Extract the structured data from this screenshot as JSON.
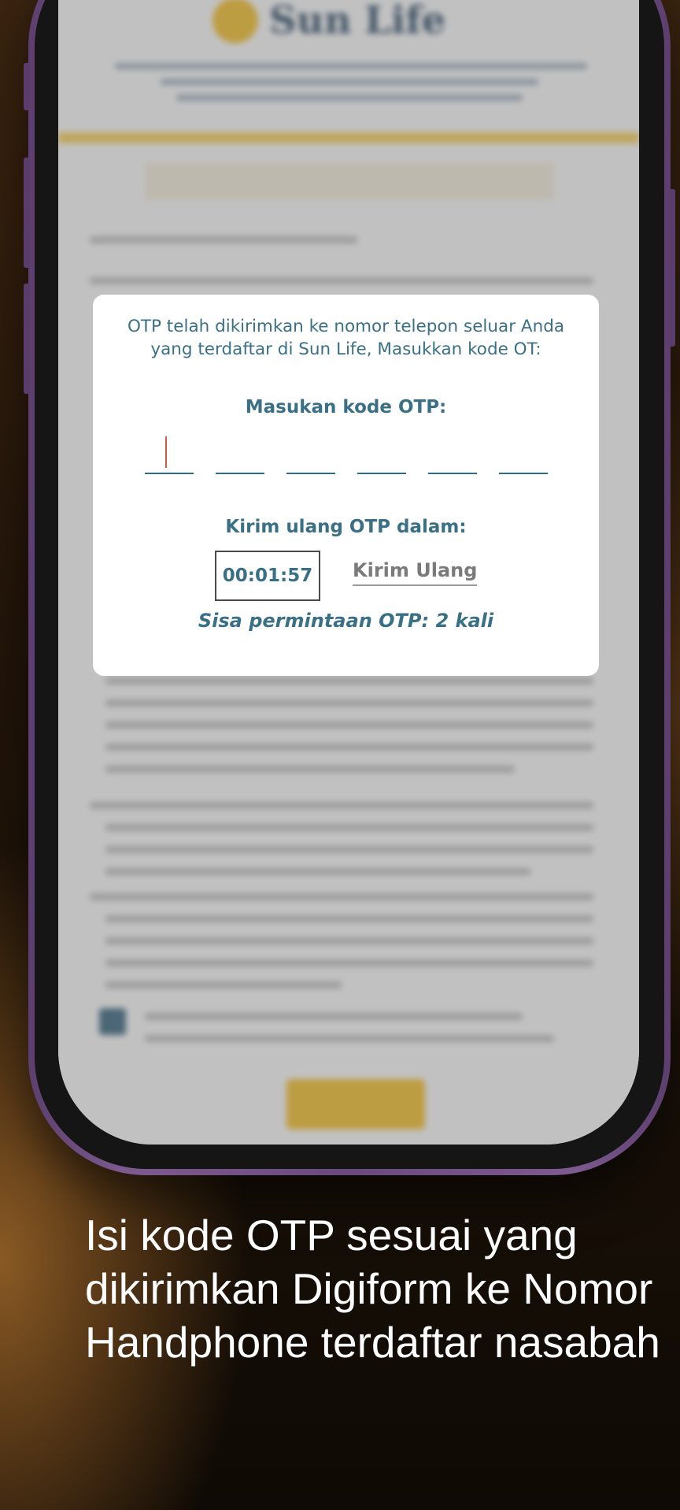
{
  "blurred_page": {
    "logo_text": "Sun Life"
  },
  "otp_dialog": {
    "message": "OTP telah dikirimkan ke nomor telepon seluar Anda yang terdaftar di Sun Life, Masukkan kode OT:",
    "otp_label": "Masukan kode OTP:",
    "otp_digit_count": 6,
    "resend_label": "Kirim ulang OTP dalam:",
    "timer": "00:01:57",
    "resend_button": "Kirim Ulang",
    "remaining_requests": "Sisa permintaan OTP: 2 kali"
  },
  "caption": "Isi kode OTP sesuai yang dikirimkan Digiform ke Nomor Handphone terdaftar nasabah",
  "colors": {
    "dialog_text": "#3a7086",
    "brand_yellow": "#f0b81c",
    "phone_frame": "#6a4a7c"
  }
}
